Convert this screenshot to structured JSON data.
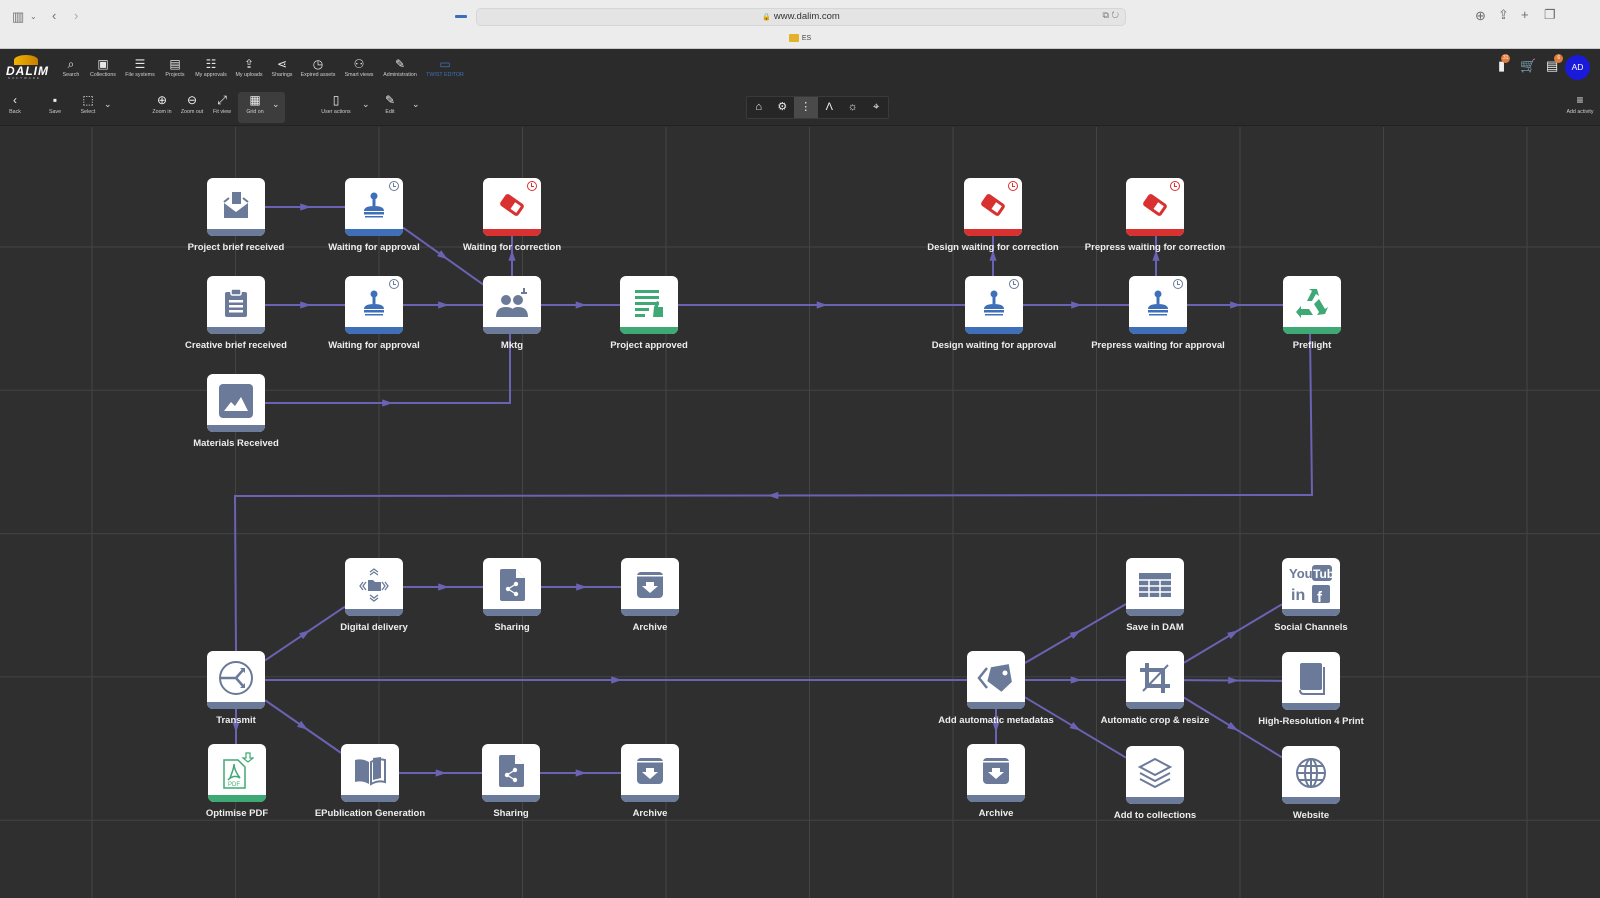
{
  "browser": {
    "url": "www.dalim.com",
    "tab_label": "ES",
    "icons": [
      "sidebar-icon",
      "chevron-down-icon",
      "back-icon",
      "forward-icon",
      "download-icon",
      "share-icon",
      "new-tab-icon",
      "tabs-icon"
    ]
  },
  "app": {
    "brand": "DALIM",
    "brand_sub": "SOFTWARE",
    "nav": [
      {
        "label": "Search",
        "icon": "search-icon"
      },
      {
        "label": "Collections",
        "icon": "collections-icon"
      },
      {
        "label": "File systems",
        "icon": "database-icon"
      },
      {
        "label": "Projects",
        "icon": "briefcase-icon"
      },
      {
        "label": "My approvals",
        "icon": "checklist-icon"
      },
      {
        "label": "My uploads",
        "icon": "upload-icon"
      },
      {
        "label": "Sharings",
        "icon": "share-icon"
      },
      {
        "label": "Expired assets",
        "icon": "clock-icon"
      },
      {
        "label": "Smart views",
        "icon": "user-search-icon"
      },
      {
        "label": "Administration",
        "icon": "wrench-icon"
      },
      {
        "label": "TWIST EDITOR",
        "icon": "monitor-icon",
        "active": true
      }
    ],
    "header_right": {
      "notifications_badge": "31",
      "tasks_badge": "6",
      "avatar_initials": "AD"
    }
  },
  "toolbar": {
    "back": "Back",
    "save": "Save",
    "select": "Select",
    "zoom_in": "Zoom in",
    "zoom_out": "Zoom out",
    "fit_view": "Fit view",
    "grid_on": "Grid on",
    "user_actions": "User actions",
    "edit": "Edit",
    "add_activity": "Add activity",
    "modes": [
      {
        "icon": "home-icon",
        "active": false
      },
      {
        "icon": "robot-arm-icon",
        "active": false
      },
      {
        "icon": "workflow-icon",
        "active": true
      },
      {
        "icon": "compass-icon",
        "active": false
      },
      {
        "icon": "fire-icon",
        "active": false
      },
      {
        "icon": "chart-search-icon",
        "active": false
      }
    ]
  },
  "colors": {
    "accent": "#3f73b5",
    "edge": "#6a62b3",
    "node_default": "#6b7a99",
    "status_approval": "#3f6fb8",
    "status_correction": "#d93030",
    "status_success": "#3fa976",
    "avatar": "#1a1adb",
    "badge": "#e07b39"
  },
  "workflow": {
    "nodes": [
      {
        "id": "n1",
        "label": "Project brief received",
        "icon": "envelope-doc-icon",
        "status": "default"
      },
      {
        "id": "n2",
        "label": "Waiting for approval",
        "icon": "stamp-icon",
        "status": "approval",
        "timer": true
      },
      {
        "id": "n3",
        "label": "Waiting for correction",
        "icon": "eraser-icon",
        "status": "correction",
        "timer": true
      },
      {
        "id": "n4",
        "label": "Creative brief received",
        "icon": "clipboard-icon",
        "status": "default"
      },
      {
        "id": "n5",
        "label": "Waiting for approval",
        "icon": "stamp-icon",
        "status": "approval",
        "timer": true
      },
      {
        "id": "n6",
        "label": "Mktg",
        "icon": "group-icon",
        "status": "default",
        "stamp": true
      },
      {
        "id": "n7",
        "label": "Project approved",
        "icon": "doc-thumbsup-icon",
        "status": "success"
      },
      {
        "id": "n8",
        "label": "Materials Received",
        "icon": "image-icon",
        "status": "default"
      },
      {
        "id": "n9",
        "label": "Design waiting for correction",
        "icon": "eraser-icon",
        "status": "correction",
        "timer": true
      },
      {
        "id": "n10",
        "label": "Prepress waiting for correction",
        "icon": "eraser-icon",
        "status": "correction",
        "timer": true
      },
      {
        "id": "n11",
        "label": "Design waiting for approval",
        "icon": "stamp-icon",
        "status": "approval",
        "timer": true
      },
      {
        "id": "n12",
        "label": "Prepress waiting for approval",
        "icon": "stamp-icon",
        "status": "approval",
        "timer": true
      },
      {
        "id": "n13",
        "label": "Preflight",
        "icon": "recycle-icon",
        "status": "success"
      },
      {
        "id": "n14",
        "label": "Digital delivery",
        "icon": "folder-arrows-icon",
        "status": "default"
      },
      {
        "id": "n15",
        "label": "Sharing",
        "icon": "doc-share-icon",
        "status": "default"
      },
      {
        "id": "n16",
        "label": "Archive",
        "icon": "archive-icon",
        "status": "default"
      },
      {
        "id": "n17",
        "label": "Transmit",
        "icon": "transmit-icon",
        "status": "default"
      },
      {
        "id": "n18",
        "label": "Optimise PDF",
        "icon": "pdf-icon",
        "status": "success"
      },
      {
        "id": "n19",
        "label": "EPublication Generation",
        "icon": "book-open-icon",
        "status": "default"
      },
      {
        "id": "n20",
        "label": "Sharing",
        "icon": "doc-share-icon",
        "status": "default"
      },
      {
        "id": "n21",
        "label": "Archive",
        "icon": "archive-icon",
        "status": "default"
      },
      {
        "id": "n22",
        "label": "Add automatic metadatas",
        "icon": "tag-icon",
        "status": "default"
      },
      {
        "id": "n23",
        "label": "Save in DAM",
        "icon": "table-icon",
        "status": "default"
      },
      {
        "id": "n24",
        "label": "Automatic crop & resize",
        "icon": "crop-icon",
        "status": "default"
      },
      {
        "id": "n25",
        "label": "Social Channels",
        "icon": "social-icon",
        "status": "default"
      },
      {
        "id": "n26",
        "label": "High-Resolution 4 Print",
        "icon": "book-icon",
        "status": "default"
      },
      {
        "id": "n27",
        "label": "Archive",
        "icon": "archive-icon",
        "status": "default"
      },
      {
        "id": "n28",
        "label": "Add to collections",
        "icon": "layers-icon",
        "status": "default"
      },
      {
        "id": "n29",
        "label": "Website",
        "icon": "globe-icon",
        "status": "default"
      }
    ],
    "edges": [
      [
        "n1",
        "n2"
      ],
      [
        "n2",
        "n6"
      ],
      [
        "n6",
        "n3"
      ],
      [
        "n4",
        "n5"
      ],
      [
        "n5",
        "n6"
      ],
      [
        "n8",
        "n6"
      ],
      [
        "n6",
        "n7"
      ],
      [
        "n7",
        "n11"
      ],
      [
        "n11",
        "n9"
      ],
      [
        "n11",
        "n12"
      ],
      [
        "n12",
        "n10"
      ],
      [
        "n12",
        "n13"
      ],
      [
        "n13",
        "n17"
      ],
      [
        "n17",
        "n14"
      ],
      [
        "n14",
        "n15"
      ],
      [
        "n15",
        "n16"
      ],
      [
        "n17",
        "n18"
      ],
      [
        "n17",
        "n19"
      ],
      [
        "n19",
        "n20"
      ],
      [
        "n20",
        "n21"
      ],
      [
        "n17",
        "n22"
      ],
      [
        "n22",
        "n23"
      ],
      [
        "n22",
        "n24"
      ],
      [
        "n22",
        "n27"
      ],
      [
        "n22",
        "n28"
      ],
      [
        "n24",
        "n25"
      ],
      [
        "n24",
        "n26"
      ],
      [
        "n24",
        "n29"
      ]
    ]
  }
}
